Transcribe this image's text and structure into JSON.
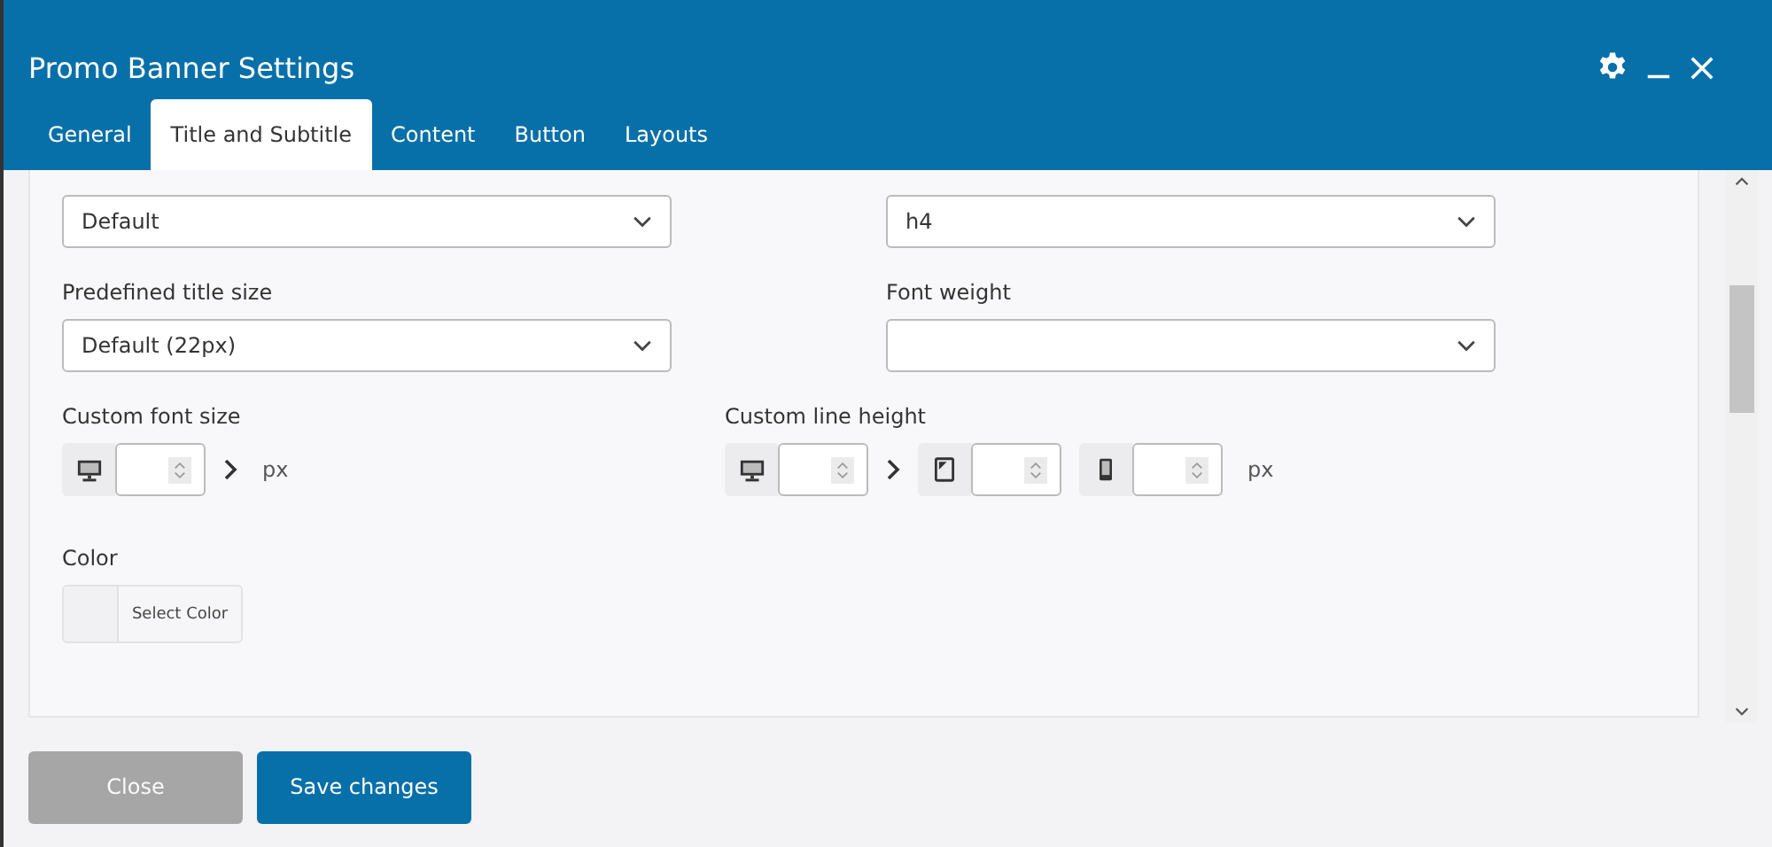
{
  "window": {
    "title": "Promo Banner Settings"
  },
  "tabs": [
    {
      "label": "General",
      "selected": false
    },
    {
      "label": "Title and Subtitle",
      "selected": true
    },
    {
      "label": "Content",
      "selected": false
    },
    {
      "label": "Button",
      "selected": false
    },
    {
      "label": "Layouts",
      "selected": false
    }
  ],
  "selects": [
    {
      "value": "Default"
    },
    {
      "value": "h4"
    },
    {
      "label": "Predefined title size",
      "value": "Default (22px)"
    },
    {
      "label": "Font weight"
    }
  ],
  "custom_font_size": {
    "label": "Custom font size",
    "unit": "px",
    "devices": [
      {
        "kind": "desktop"
      }
    ]
  },
  "custom_line_height": {
    "label": "Custom line height",
    "unit": "px",
    "devices": [
      {
        "kind": "desktop"
      },
      {
        "kind": "tablet"
      },
      {
        "kind": "mobile"
      }
    ]
  },
  "color": {
    "label": "Color",
    "button": "Select Color"
  },
  "buttons": [
    {
      "label": "Close",
      "kind": "secondary"
    },
    {
      "label": "Save changes",
      "kind": "primary"
    }
  ]
}
